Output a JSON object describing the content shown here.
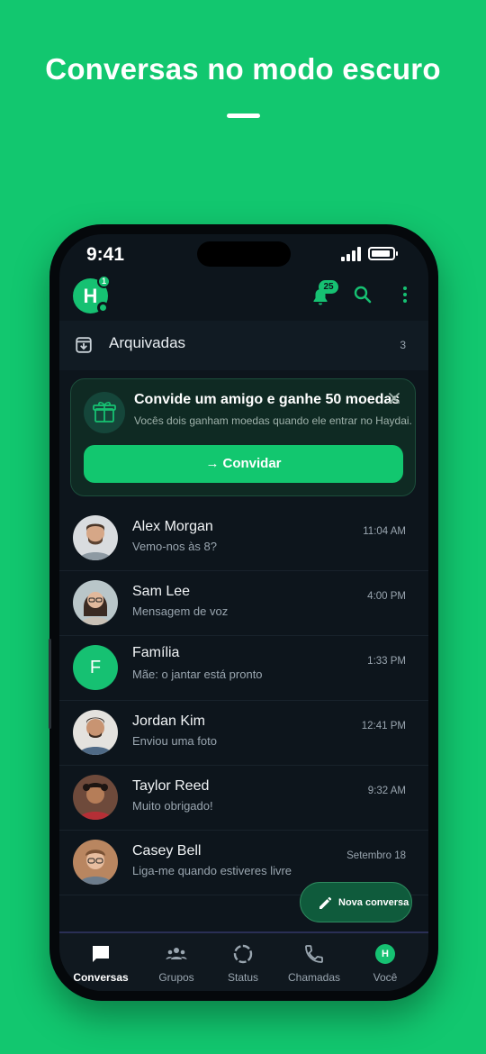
{
  "headline": "Conversas no modo escuro",
  "status_bar": {
    "time": "9:41"
  },
  "app_bar": {
    "logo_letter": "H",
    "logo_badge": "1",
    "notification_count": "25"
  },
  "archived": {
    "label": "Arquivadas",
    "count": "3"
  },
  "invite_card": {
    "title": "Convide um amigo e ganhe 50 moedas",
    "subtitle": "Vocês dois ganham moedas quando ele entrar no Haydai.",
    "button_label": "Convidar"
  },
  "chats": [
    {
      "name": "Alex Morgan",
      "message": "Vemo-nos às 8?",
      "time": "11:04 AM",
      "avatar": "photo-man-beard"
    },
    {
      "name": "Sam Lee",
      "message": "Mensagem de voz",
      "time": "4:00 PM",
      "avatar": "photo-woman-glasses"
    },
    {
      "name": "Família",
      "message": "Mãe: o jantar está pronto",
      "time": "1:33 PM",
      "avatar_letter": "F"
    },
    {
      "name": "Jordan Kim",
      "message": "Enviou uma foto",
      "time": "12:41 PM",
      "avatar": "photo-man-smiling"
    },
    {
      "name": "Taylor Reed",
      "message": "Muito obrigado!",
      "time": "9:32 AM",
      "avatar": "photo-man-curly"
    },
    {
      "name": "Casey Bell",
      "message": "Liga-me quando estiveres livre",
      "time": "Setembro 18",
      "avatar": "photo-man-glasses"
    }
  ],
  "fab": {
    "label": "Nova conversa"
  },
  "bottom_nav": [
    {
      "label": "Conversas",
      "icon": "chat-icon",
      "active": true
    },
    {
      "label": "Grupos",
      "icon": "groups-icon",
      "active": false
    },
    {
      "label": "Status",
      "icon": "status-icon",
      "active": false
    },
    {
      "label": "Chamadas",
      "icon": "phone-icon",
      "active": false
    },
    {
      "label": "Você",
      "icon": "profile-logo-icon",
      "active": false,
      "logo_letter": "H"
    }
  ],
  "colors": {
    "brand": "#12c76f",
    "background": "#0d151c",
    "surface": "#111b23"
  }
}
